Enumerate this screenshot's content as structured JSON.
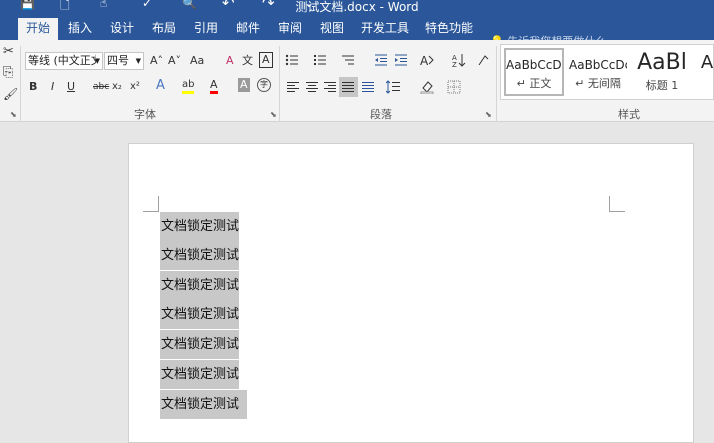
{
  "window": {
    "title": "测试文档.docx - Word"
  },
  "quick_access": {
    "save": "💾",
    "new": "🗋",
    "touch": "☝",
    "check": "✓",
    "preview": "🔍",
    "undo": "↶",
    "redo": "↷",
    "more": "⌄"
  },
  "tabs": [
    "开始",
    "插入",
    "设计",
    "布局",
    "引用",
    "邮件",
    "审阅",
    "视图",
    "开发工具",
    "特色功能"
  ],
  "tell_me": "告诉我您想要做什么...",
  "font_group": {
    "label": "字体",
    "font_name": "等线 (中文正文)",
    "font_size": "四号",
    "grow": "A˄",
    "shrink": "A˅",
    "case": "Aa",
    "clear": "A",
    "pinyin": "文",
    "border_char": "A",
    "bold": "B",
    "italic": "I",
    "underline": "U",
    "strike": "abc",
    "subscript": "x₂",
    "superscript": "x²",
    "effects": "A",
    "highlight": "ab",
    "font_color": "A",
    "shading": "A",
    "enclose": "字"
  },
  "paragraph_group": {
    "label": "段落"
  },
  "styles_group": {
    "label": "样式",
    "items": [
      {
        "sample": "AaBbCcDc",
        "name": "正文"
      },
      {
        "sample": "AaBbCcDc",
        "name": "无间隔"
      },
      {
        "sample": "AaBl",
        "name": "标题 1"
      },
      {
        "sample": "A",
        "name": ""
      }
    ]
  },
  "clipboard": {
    "cut": "✂",
    "copy": "⎘",
    "paste_format": "🖌"
  },
  "document": {
    "lines": [
      "文档锁定测试",
      "文档锁定测试",
      "文档锁定测试",
      "文档锁定测试",
      "文档锁定测试",
      "文档锁定测试",
      "文档锁定测试"
    ]
  },
  "colors": {
    "accent": "#2b579a",
    "highlight": "#ffff00",
    "font_color_bar": "#ff0000",
    "selection": "#c8c8c8"
  }
}
